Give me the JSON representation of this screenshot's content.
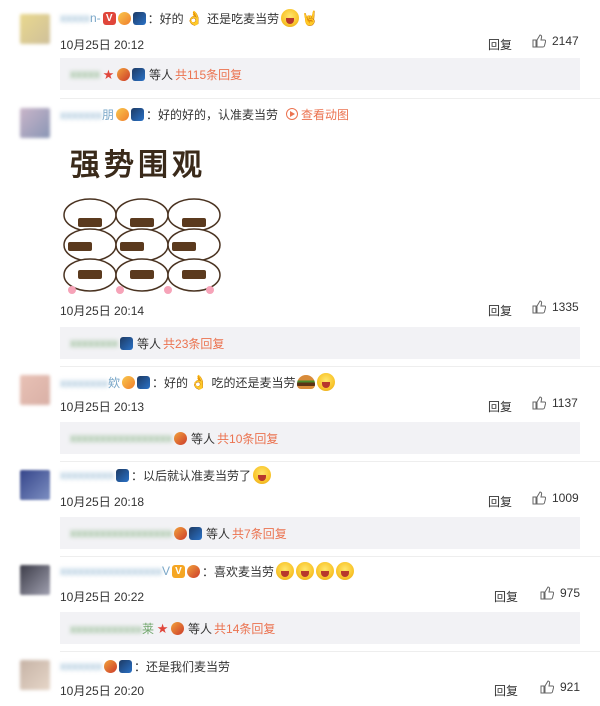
{
  "comments": [
    {
      "username": "n-",
      "text": "：好的",
      "text2": "还是吃麦当劳",
      "time": "10月25日 20:12",
      "reply_label": "回复",
      "likes": "2147",
      "sub": {
        "users": "",
        "deng": "等人",
        "more": "共115条回复"
      }
    },
    {
      "username": "朋",
      "text": "：好的好的，认准麦当劳",
      "link": "查看动图",
      "sticker_text": "强势围观",
      "time": "10月25日 20:14",
      "reply_label": "回复",
      "likes": "1335",
      "sub": {
        "users": "",
        "deng": "等人",
        "more": "共23条回复"
      }
    },
    {
      "username": "欸",
      "text": "：好的",
      "text2": "吃的还是麦当劳",
      "time": "10月25日 20:13",
      "reply_label": "回复",
      "likes": "1137",
      "sub": {
        "users": "",
        "deng": "等人",
        "more": "共10条回复"
      }
    },
    {
      "username": "",
      "text": "：以后就认准麦当劳了",
      "time": "10月25日 20:18",
      "reply_label": "回复",
      "likes": "1009",
      "sub": {
        "users": "",
        "deng": "等人",
        "more": "共7条回复"
      }
    },
    {
      "username": "V",
      "text": "：喜欢麦当劳",
      "time": "10月25日 20:22",
      "reply_label": "回复",
      "likes": "975",
      "sub": {
        "users": "莱",
        "deng": "等人",
        "more": "共14条回复"
      }
    },
    {
      "username": "",
      "text": "：还是我们麦当劳",
      "time": "10月25日 20:20",
      "reply_label": "回复",
      "likes": "921"
    }
  ],
  "colors": {
    "accent": "#eb7350",
    "link_user": "#eb7350",
    "subbox_bg": "#f2f2f5"
  },
  "icons": {
    "like": "thumbs-up-icon",
    "emoji": "laughing-face-icon",
    "play": "play-circle-icon"
  }
}
